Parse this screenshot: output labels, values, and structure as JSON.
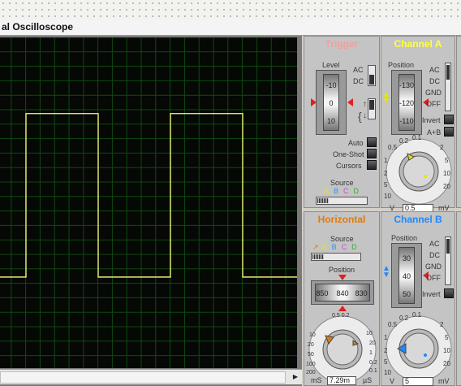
{
  "window": {
    "title": "al Oscilloscope"
  },
  "trace": {
    "color": "#ffff80",
    "period_divisions": 10,
    "duty": 0.5
  },
  "trigger": {
    "title": "Trigger",
    "title_color": "#f0a0a0",
    "level_label": "Level",
    "level_ticks": [
      "-10",
      "0",
      "10"
    ],
    "ac": "AC",
    "dc": "DC",
    "auto": "Auto",
    "one_shot": "One-Shot",
    "cursors": "Cursors",
    "source_label": "Source",
    "sources": [
      {
        "t": "A",
        "c": "#e6e600"
      },
      {
        "t": "B",
        "c": "#3a8fd8"
      },
      {
        "t": "C",
        "c": "#c94ad6"
      },
      {
        "t": "D",
        "c": "#3aa83a"
      }
    ]
  },
  "channel_a": {
    "title": "Channel A",
    "title_color": "#ffff40",
    "position_label": "Position",
    "position_ticks": [
      "-130",
      "-120",
      "-110"
    ],
    "ac": "AC",
    "dc": "DC",
    "gnd": "GND",
    "off": "OFF",
    "invert": "Invert",
    "a_plus_b": "A+B",
    "scale": [
      "0.1",
      "0.2",
      "0.5",
      "1",
      "2",
      "5",
      "10",
      "20"
    ],
    "scale_right": [
      "2",
      "5",
      "10",
      "20"
    ],
    "value": "0.5",
    "unit_left": "V",
    "unit_right": "mV"
  },
  "horizontal": {
    "title": "Horizontal",
    "title_color": "#e07a10",
    "source_label": "Source",
    "sources": [
      {
        "t": "A",
        "c": "#e6e600"
      },
      {
        "t": "B",
        "c": "#3a8fd8"
      },
      {
        "t": "C",
        "c": "#c94ad6"
      },
      {
        "t": "D",
        "c": "#3aa83a"
      }
    ],
    "position_label": "Position",
    "position_ticks": [
      "850",
      "840",
      "830"
    ],
    "scale_left": [
      "10",
      "20",
      "50",
      "100",
      "200",
      "500",
      "1",
      "2"
    ],
    "scale_top": [
      "0.5",
      "0.2",
      "0.1",
      "0.05",
      "0.02",
      "0.01"
    ],
    "scale_right": [
      "1",
      "2",
      "5",
      "10",
      "20",
      "50",
      "0.1",
      "0.2",
      "0.5"
    ],
    "value": "7.29m",
    "unit_left": "mS",
    "unit_right": "µS"
  },
  "channel_b": {
    "title": "Channel B",
    "title_color": "#1f88ff",
    "position_label": "Position",
    "position_ticks": [
      "30",
      "40",
      "50"
    ],
    "ac": "AC",
    "dc": "DC",
    "gnd": "GND",
    "off": "OFF",
    "invert": "Invert",
    "scale": [
      "0.1",
      "0.2",
      "0.5",
      "1",
      "2",
      "5",
      "10",
      "20"
    ],
    "scale_right": [
      "2",
      "5",
      "10",
      "20"
    ],
    "value": "5",
    "unit_left": "V",
    "unit_right": "mV"
  }
}
